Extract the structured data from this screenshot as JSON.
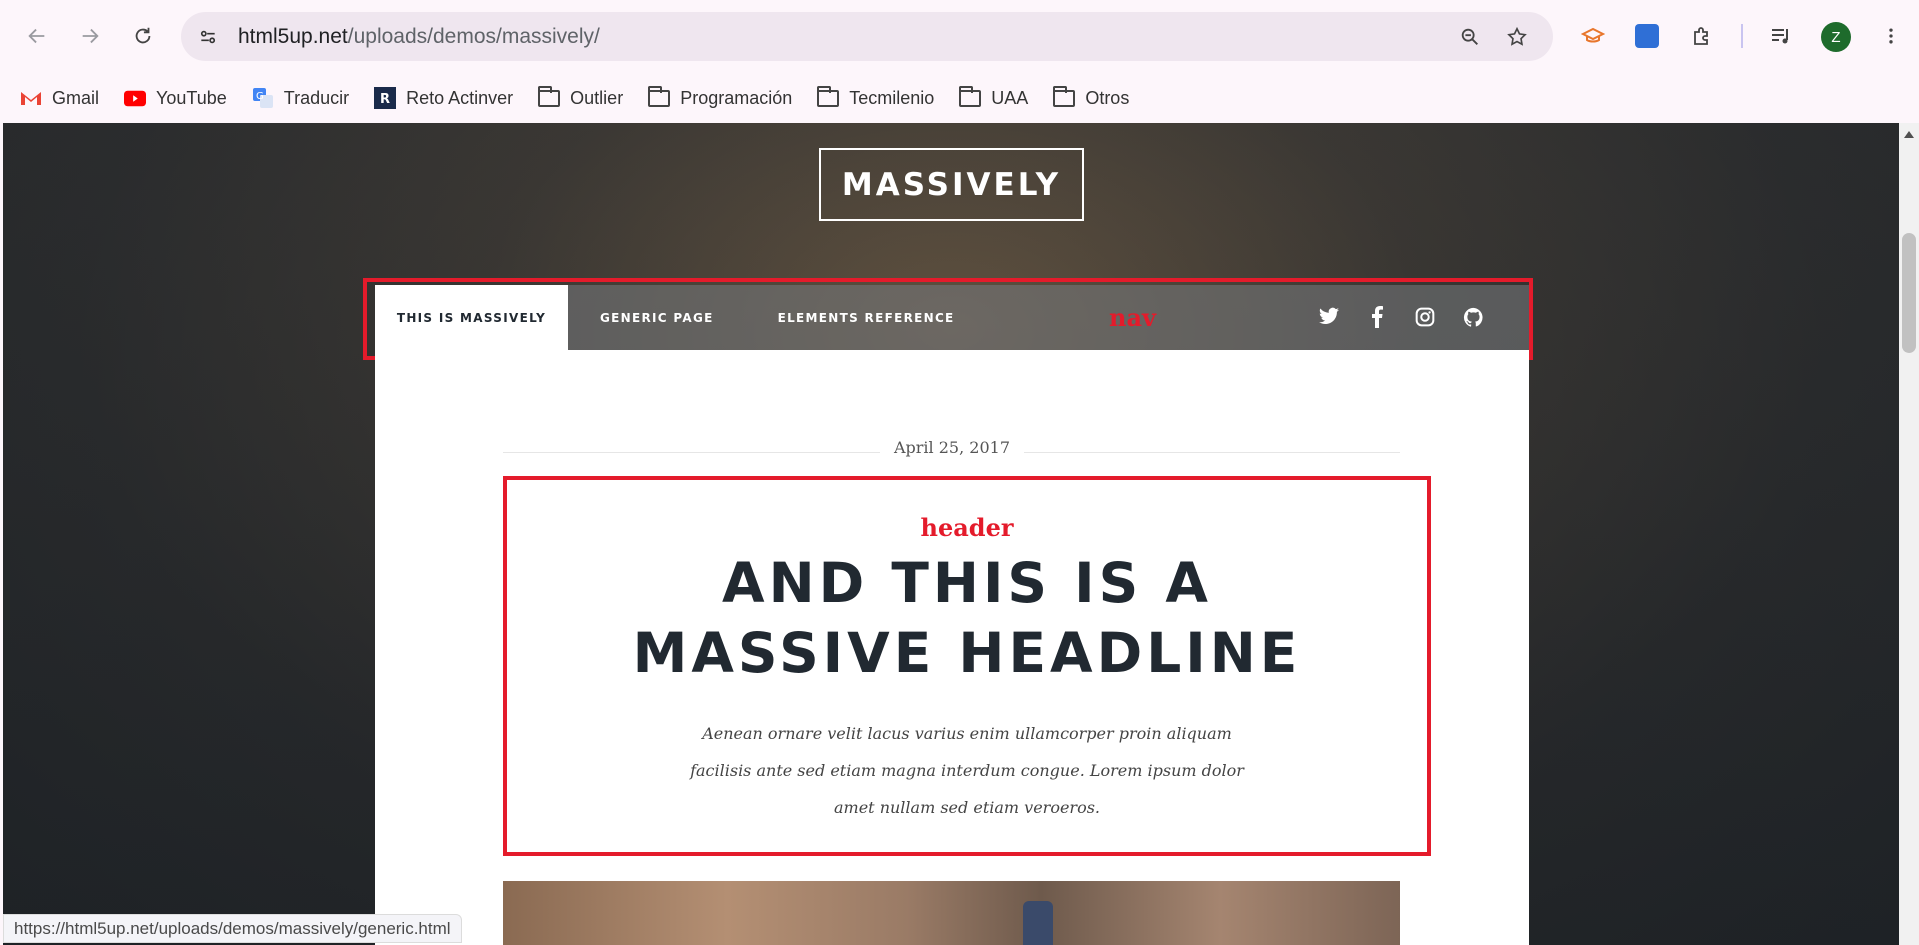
{
  "browser": {
    "url_host": "html5up.net",
    "url_path": "/uploads/demos/massively/",
    "profile_initial": "Z",
    "status_url": "https://html5up.net/uploads/demos/massively/generic.html"
  },
  "bookmarks": [
    {
      "label": "Gmail",
      "icon": "gmail-icon"
    },
    {
      "label": "YouTube",
      "icon": "youtube-icon"
    },
    {
      "label": "Traducir",
      "icon": "translate-icon"
    },
    {
      "label": "Reto Actinver",
      "icon": "actinver-icon"
    },
    {
      "label": "Outlier",
      "icon": "folder-icon"
    },
    {
      "label": "Programación",
      "icon": "folder-icon"
    },
    {
      "label": "Tecmilenio",
      "icon": "folder-icon"
    },
    {
      "label": "UAA",
      "icon": "folder-icon"
    },
    {
      "label": "Otros",
      "icon": "folder-icon"
    }
  ],
  "site": {
    "logo": "MASSIVELY",
    "nav": {
      "tabs": [
        {
          "label": "THIS IS MASSIVELY",
          "active": true
        },
        {
          "label": "GENERIC PAGE",
          "active": false
        },
        {
          "label": "ELEMENTS REFERENCE",
          "active": false
        }
      ],
      "annotation": "nav",
      "social": [
        "twitter-icon",
        "facebook-icon",
        "instagram-icon",
        "github-icon"
      ]
    },
    "post": {
      "date": "April 25, 2017",
      "annotation": "header",
      "headline_line1": "AND THIS IS A",
      "headline_line2": "MASSIVE HEADLINE",
      "description_line1": "Aenean ornare velit lacus varius enim ullamcorper proin aliquam",
      "description_line2": "facilisis ante sed etiam magna interdum congue. Lorem ipsum dolor",
      "description_line3": "amet nullam sed etiam veroeros."
    }
  },
  "colors": {
    "annotation_red": "#e41b2b",
    "headline": "#212931",
    "avatar_green": "#1e6b2c"
  }
}
